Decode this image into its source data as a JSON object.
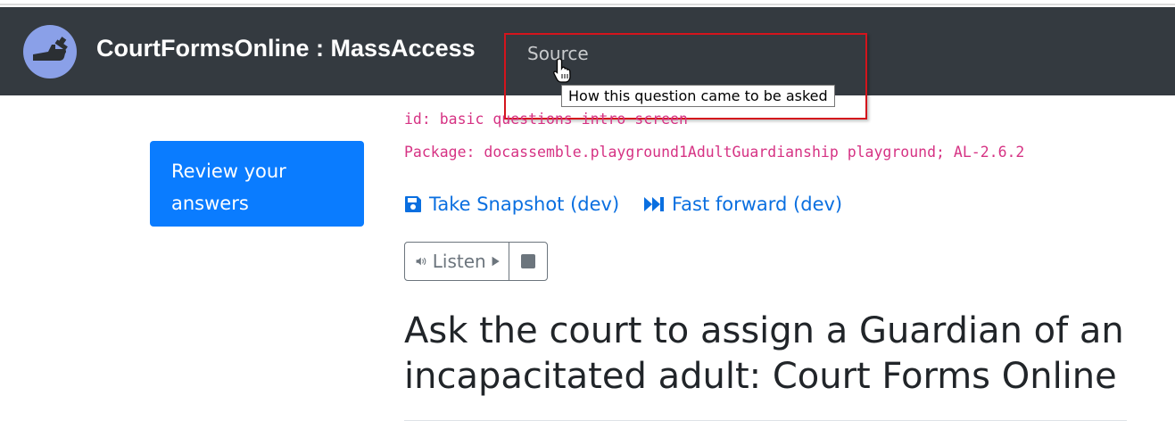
{
  "navbar": {
    "logo_icon": "hand-gavel-icon",
    "brand": "CourtFormsOnline : MassAccess",
    "source_link": "Source",
    "tooltip": "How this question came to be asked",
    "background": "#343a40"
  },
  "sidebar": {
    "review_button": "Review your answers",
    "review_button_color": "#0a7cff"
  },
  "main": {
    "id_line": "id: basic questions intro screen",
    "package_line": "Package: docassemble.playground1AdultGuardianship playground; AL-2.6.2",
    "snapshot_link": "Take Snapshot (dev)",
    "snapshot_icon": "save-icon",
    "fastforward_link": "Fast forward (dev)",
    "fastforward_icon": "fast-forward-icon",
    "listen_label": "Listen",
    "speaker_icon": "volume-icon",
    "play_icon": "play-icon",
    "stop_icon": "stop-icon",
    "heading": "Ask the court to assign a Guardian of an incapacitated adult: Court Forms Online",
    "mono_color": "#d63384",
    "link_color": "#0a6fe0"
  }
}
